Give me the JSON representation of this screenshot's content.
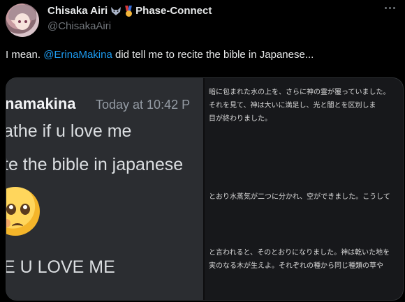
{
  "author": {
    "display_name": "Chisaka Airi",
    "badge_org": "Phase-Connect",
    "handle": "@ChisakaAiri"
  },
  "tweet": {
    "text_before": "I mean. ",
    "mention": "@ErinaMakina",
    "text_after": " did tell me to recite the bible in Japanese..."
  },
  "media": {
    "discord": {
      "username": "namakina",
      "timestamp": "Today at 10:42 P",
      "line1": "athe if u love me",
      "line2": "te the bible in japanese",
      "line3": "E U LOVE ME"
    },
    "japanese_lines": [
      "暗に包まれた水の上を、さらに神の霊が覆っていました。",
      "それを見て、神は大いに満足し、光と闇とを区別しま",
      "目が終わりました。",
      "とおり水蒸気が二つに分かれ、空ができました。こうして",
      "と言われると、そのとおりになりました。神は乾いた地を",
      "実のなる木が生えよ。それぞれの種から同じ種類の草や"
    ]
  },
  "icons": {
    "more": "more-options-icon",
    "wolf": "wolf-emoji-icon",
    "medal": "medal-emoji-icon",
    "pleading": "pleading-face-emoji"
  },
  "colors": {
    "background": "#000000",
    "link": "#1d9bf0",
    "text": "#e7e9ea",
    "muted": "#71767b"
  }
}
